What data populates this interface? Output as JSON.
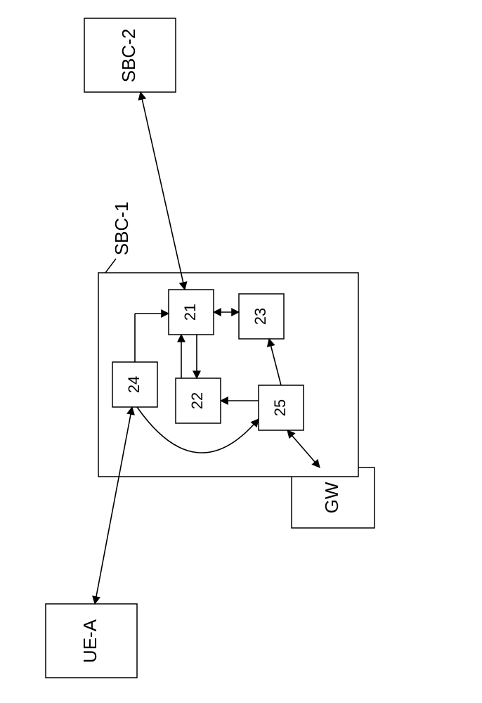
{
  "nodes": {
    "sbc1_label": "SBC-1",
    "sbc2": "SBC-2",
    "ue_a": "UE-A",
    "gw": "GW",
    "n21": "21",
    "n22": "22",
    "n23": "23",
    "n24": "24",
    "n25": "25"
  }
}
